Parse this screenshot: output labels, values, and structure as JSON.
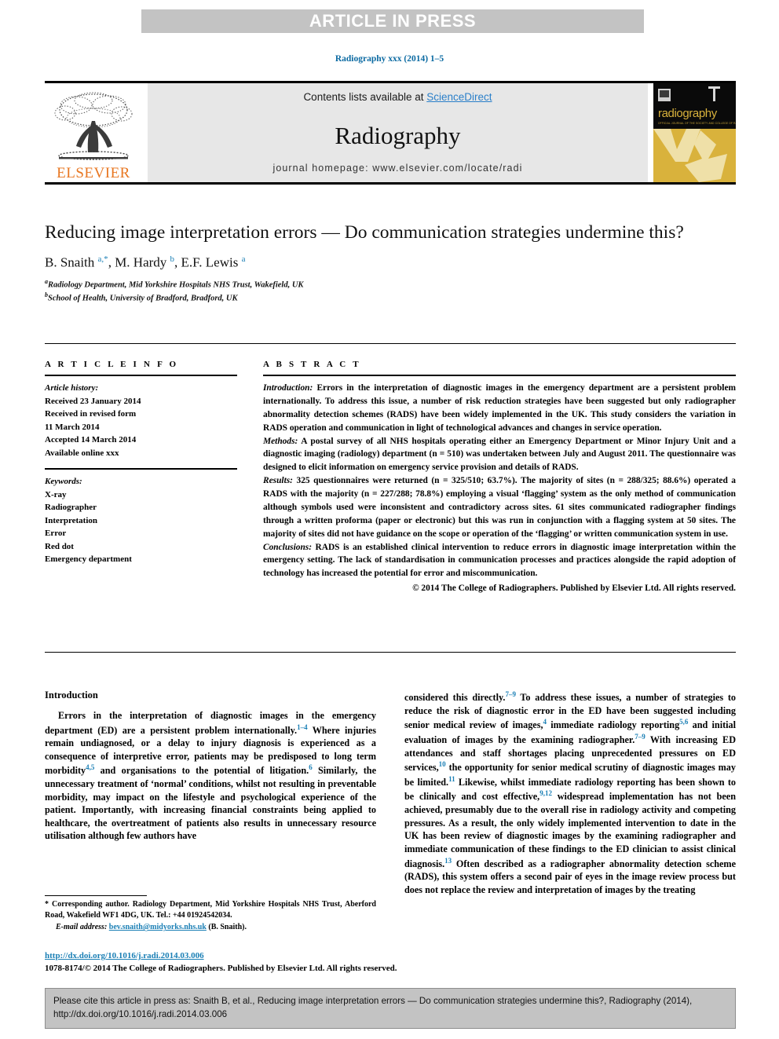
{
  "banner": {
    "label": "ARTICLE IN PRESS"
  },
  "journal_ref": "Radiography xxx (2014) 1–5",
  "masthead": {
    "contents_prefix": "Contents lists available at ",
    "sciencedirect": "ScienceDirect",
    "journal_title": "Radiography",
    "homepage": "journal homepage: www.elsevier.com/locate/radi",
    "publisher_word": "ELSEVIER",
    "cover_title": "radiography",
    "cover_subtitle": "OFFICIAL JOURNAL OF THE SOCIETY AND COLLEGE OF RADIOGRAPHERS",
    "accent_blue": "#2a7fc9",
    "elsevier_orange": "#e87722",
    "cover_gold": "#d9b23c"
  },
  "article": {
    "title": "Reducing image interpretation errors — Do communication strategies undermine this?",
    "authors_html": "B. Snaith <sup class=\"aff-mark\">a,*</sup>, M. Hardy <sup class=\"aff-mark\">b</sup>, E.F. Lewis <sup class=\"aff-mark\">a</sup>",
    "affiliations": [
      "Radiology Department, Mid Yorkshire Hospitals NHS Trust, Wakefield, UK",
      "School of Health, University of Bradford, Bradford, UK"
    ],
    "affiliation_marks": [
      "a",
      "b"
    ]
  },
  "info": {
    "heading": "A R T I C L E   I N F O",
    "history_label": "Article history:",
    "history_lines": [
      "Received 23 January 2014",
      "Received in revised form",
      "11 March 2014",
      "Accepted 14 March 2014",
      "Available online xxx"
    ],
    "keywords_label": "Keywords:",
    "keywords": [
      "X-ray",
      "Radiographer",
      "Interpretation",
      "Error",
      "Red dot",
      "Emergency department"
    ]
  },
  "abstract": {
    "heading": "A B S T R A C T",
    "sections": [
      {
        "label": "Introduction:",
        "text": " Errors in the interpretation of diagnostic images in the emergency department are a persistent problem internationally. To address this issue, a number of risk reduction strategies have been suggested but only radiographer abnormality detection schemes (RADS) have been widely implemented in the UK. This study considers the variation in RADS operation and communication in light of technological advances and changes in service operation."
      },
      {
        "label": "Methods:",
        "text": " A postal survey of all NHS hospitals operating either an Emergency Department or Minor Injury Unit and a diagnostic imaging (radiology) department (n = 510) was undertaken between July and August 2011. The questionnaire was designed to elicit information on emergency service provision and details of RADS."
      },
      {
        "label": "Results:",
        "text": " 325 questionnaires were returned (n = 325/510; 63.7%). The majority of sites (n = 288/325; 88.6%) operated a RADS with the majority (n = 227/288; 78.8%) employing a visual ‘flagging’ system as the only method of communication although symbols used were inconsistent and contradictory across sites. 61 sites communicated radiographer findings through a written proforma (paper or electronic) but this was run in conjunction with a flagging system at 50 sites. The majority of sites did not have guidance on the scope or operation of the ‘flagging’ or written communication system in use."
      },
      {
        "label": "Conclusions:",
        "text": " RADS is an established clinical intervention to reduce errors in diagnostic image interpretation within the emergency setting. The lack of standardisation in communication processes and practices alongside the rapid adoption of technology has increased the potential for error and miscommunication."
      }
    ],
    "copyright": "© 2014 The College of Radiographers. Published by Elsevier Ltd. All rights reserved."
  },
  "body": {
    "intro_heading": "Introduction",
    "left_paragraph_html": "Errors in the interpretation of diagnostic images in the emergency department (ED) are a persistent problem internationally.<sup class=\"ref\">1–4</sup> Where injuries remain undiagnosed, or a delay to injury diagnosis is experienced as a consequence of interpretive error, patients may be predisposed to long term morbidity<sup class=\"ref\">4,5</sup> and organisations to the potential of litigation.<sup class=\"ref\">6</sup> Similarly, the unnecessary treatment of ‘normal’ conditions, whilst not resulting in preventable morbidity, may impact on the lifestyle and psychological experience of the patient. Importantly, with increasing financial constraints being applied to healthcare, the overtreatment of patients also results in unnecessary resource utilisation although few authors have",
    "right_paragraph_html": "considered this directly.<sup class=\"ref\">7–9</sup> To address these issues, a number of strategies to reduce the risk of diagnostic error in the ED have been suggested including senior medical review of images,<sup class=\"ref\">4</sup> immediate radiology reporting<sup class=\"ref\">5,6</sup> and initial evaluation of images by the examining radiographer.<sup class=\"ref\">7–9</sup> With increasing ED attendances and staff shortages placing unprecedented pressures on ED services,<sup class=\"ref\">10</sup> the opportunity for senior medical scrutiny of diagnostic images may be limited.<sup class=\"ref\">11</sup> Likewise, whilst immediate radiology reporting has been shown to be clinically and cost effective,<sup class=\"ref\">9,12</sup> widespread implementation has not been achieved, presumably due to the overall rise in radiology activity and competing pressures. As a result, the only widely implemented intervention to date in the UK has been review of diagnostic images by the examining radiographer and immediate communication of these findings to the ED clinician to assist clinical diagnosis.<sup class=\"ref\">13</sup> Often described as a radiographer abnormality detection scheme (RADS), this system offers a second pair of eyes in the image review process but does not replace the review and interpretation of images by the treating"
  },
  "footnote": {
    "corresponding": "* Corresponding author. Radiology Department, Mid Yorkshire Hospitals NHS Trust, Aberford Road, Wakefield WF1 4DG, UK. Tel.: +44 01924542034.",
    "email_label": "E-mail address:",
    "email": "bev.snaith@midyorks.nhs.uk",
    "email_owner": "(B. Snaith)."
  },
  "doi": {
    "url": "http://dx.doi.org/10.1016/j.radi.2014.03.006",
    "issn_line": "1078-8174/© 2014 The College of Radiographers. Published by Elsevier Ltd. All rights reserved."
  },
  "citation_box": {
    "text": "Please cite this article in press as: Snaith B, et al., Reducing image interpretation errors — Do communication strategies undermine this?, Radiography (2014), http://dx.doi.org/10.1016/j.radi.2014.03.006"
  }
}
